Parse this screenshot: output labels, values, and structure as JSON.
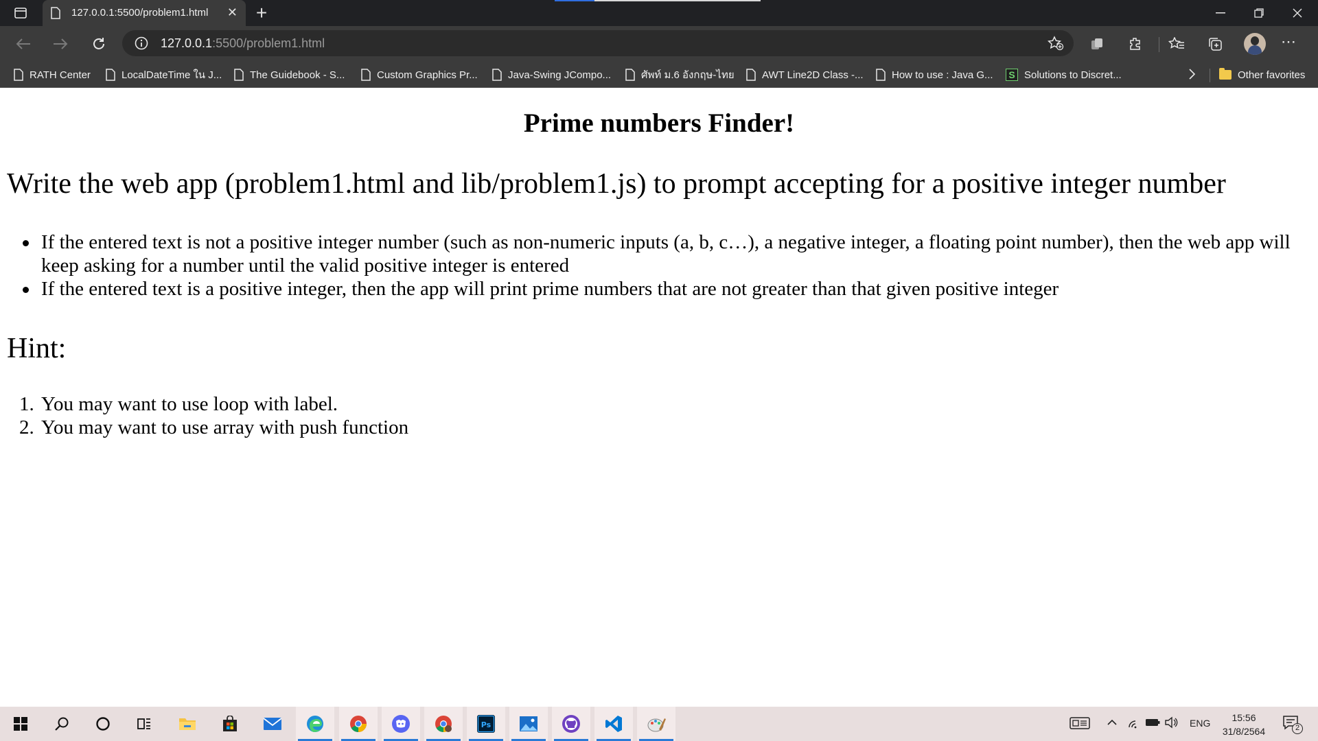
{
  "browser": {
    "tab": {
      "title": "127.0.0.1:5500/problem1.html",
      "close": "✕"
    },
    "new_tab": "+",
    "address": {
      "host": "127.0.0.1",
      "path": ":5500/problem1.html"
    },
    "more": "⋯"
  },
  "bookmarks": [
    "RATH Center",
    "LocalDateTime ใน J...",
    "The Guidebook - S...",
    "Custom Graphics Pr...",
    "Java-Swing JCompo...",
    "ศัพท์ ม.6 อังกฤษ-ไทย",
    "AWT Line2D Class -...",
    "How to use : Java G...",
    "Solutions to Discret..."
  ],
  "bookmark_s_letter": "S",
  "other_favorites": "Other favorites",
  "page": {
    "title": "Prime numbers Finder!",
    "intro": "Write the web app (problem1.html and lib/problem1.js) to prompt accepting for a positive integer number",
    "rules": [
      "If the entered text is not a positive integer number (such as non-numeric inputs (a, b, c…), a negative integer, a floating point number), then the web app will keep asking for a number until the valid positive integer is entered",
      "If the entered text is a positive integer, then the app will print prime numbers that are not greater than that given positive integer"
    ],
    "hint_heading": "Hint:",
    "hints": [
      {
        "num": "1.",
        "text": "You may want to use loop with label."
      },
      {
        "num": "2.",
        "text": "You may want to use array with push function"
      }
    ]
  },
  "taskbar": {
    "language": "ENG",
    "time": "15:56",
    "date": "31/8/2564",
    "notifications": "2",
    "apps": [
      "start-icon",
      "search-icon",
      "cortana-icon",
      "task-view-icon",
      "file-explorer-icon",
      "store-icon",
      "mail-icon",
      "edge-icon",
      "chrome-icon",
      "discord-icon",
      "chrome-profile-icon",
      "photoshop-icon",
      "photos-icon",
      "github-desktop-icon",
      "vscode-icon",
      "paint-icon"
    ]
  }
}
